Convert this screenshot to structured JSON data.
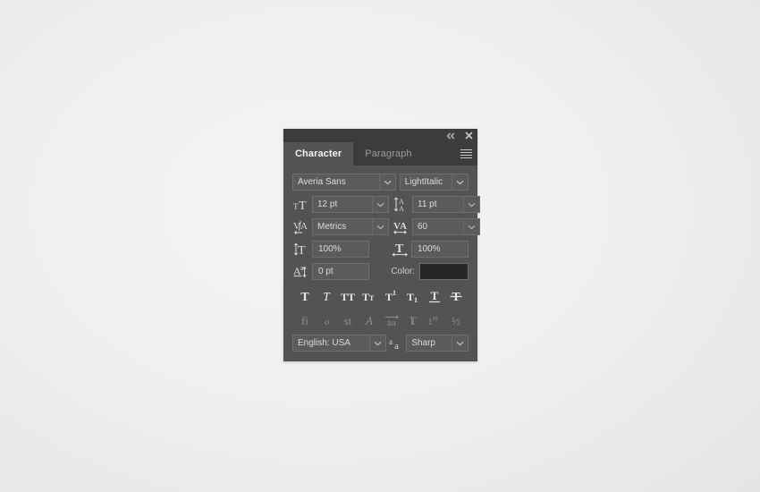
{
  "window": {
    "titlebar": {
      "collapse_icon": "double-chevron-left-icon",
      "close_icon": "close-icon"
    },
    "tabs": [
      {
        "label": "Character",
        "active": true
      },
      {
        "label": "Paragraph",
        "active": false
      }
    ],
    "panel_menu_icon": "hamburger-menu-icon"
  },
  "character": {
    "font_family": {
      "icon": "none",
      "value": "Averia Sans",
      "placeholder": "Font Family"
    },
    "font_style": {
      "value": "LightItalic",
      "placeholder": "Font Style"
    },
    "font_size": {
      "icon": "font-size-icon",
      "value": "12 pt",
      "placeholder": "Size"
    },
    "leading": {
      "icon": "leading-icon",
      "value": "11 pt",
      "placeholder": "Leading"
    },
    "kerning": {
      "icon": "kerning-icon",
      "value": "Metrics",
      "placeholder": "Kerning"
    },
    "tracking": {
      "icon": "tracking-icon",
      "value": "60",
      "placeholder": "Tracking"
    },
    "vertical_scale": {
      "icon": "vertical-scale-icon",
      "value": "100%",
      "placeholder": "Vertical Scale"
    },
    "horizontal_scale": {
      "icon": "horizontal-scale-icon",
      "value": "100%",
      "placeholder": "Horizontal Scale"
    },
    "baseline_shift": {
      "icon": "baseline-shift-icon",
      "value": "0 pt",
      "placeholder": "Baseline Shift"
    },
    "color": {
      "label": "Color:",
      "value": "#262626"
    },
    "style_buttons": [
      {
        "name": "faux-bold",
        "glyph": "T"
      },
      {
        "name": "faux-italic",
        "glyph": "T"
      },
      {
        "name": "all-caps",
        "glyph": "TT"
      },
      {
        "name": "small-caps",
        "glyph": "Tт"
      },
      {
        "name": "superscript",
        "glyph": "T1"
      },
      {
        "name": "subscript",
        "glyph": "T1"
      },
      {
        "name": "underline",
        "glyph": "T"
      },
      {
        "name": "strikethrough",
        "glyph": "T"
      }
    ],
    "opentype_buttons": [
      {
        "name": "standard-ligatures",
        "glyph": "fi"
      },
      {
        "name": "contextual-alternates",
        "glyph": "o"
      },
      {
        "name": "discretionary-ligatures",
        "glyph": "st"
      },
      {
        "name": "swash",
        "glyph": "A"
      },
      {
        "name": "oldstyle",
        "glyph": "aa"
      },
      {
        "name": "titling-alternates",
        "glyph": "T"
      },
      {
        "name": "ordinals",
        "glyph": "1st"
      },
      {
        "name": "fractions",
        "glyph": "1/2"
      }
    ],
    "language": {
      "value": "English: USA",
      "placeholder": "Language"
    },
    "anti_aliasing": {
      "icon": "anti-aliasing-icon",
      "value": "Sharp",
      "placeholder": "Anti-aliasing"
    }
  },
  "colors": {
    "panel_bg": "#535353",
    "titlebar_bg": "#3c3c3c",
    "field_bg": "#5b5b5b",
    "field_border": "#6e6e6e",
    "text": "#dcdcdc",
    "text_dim": "#9b9b9b",
    "swatch": "#262626"
  }
}
